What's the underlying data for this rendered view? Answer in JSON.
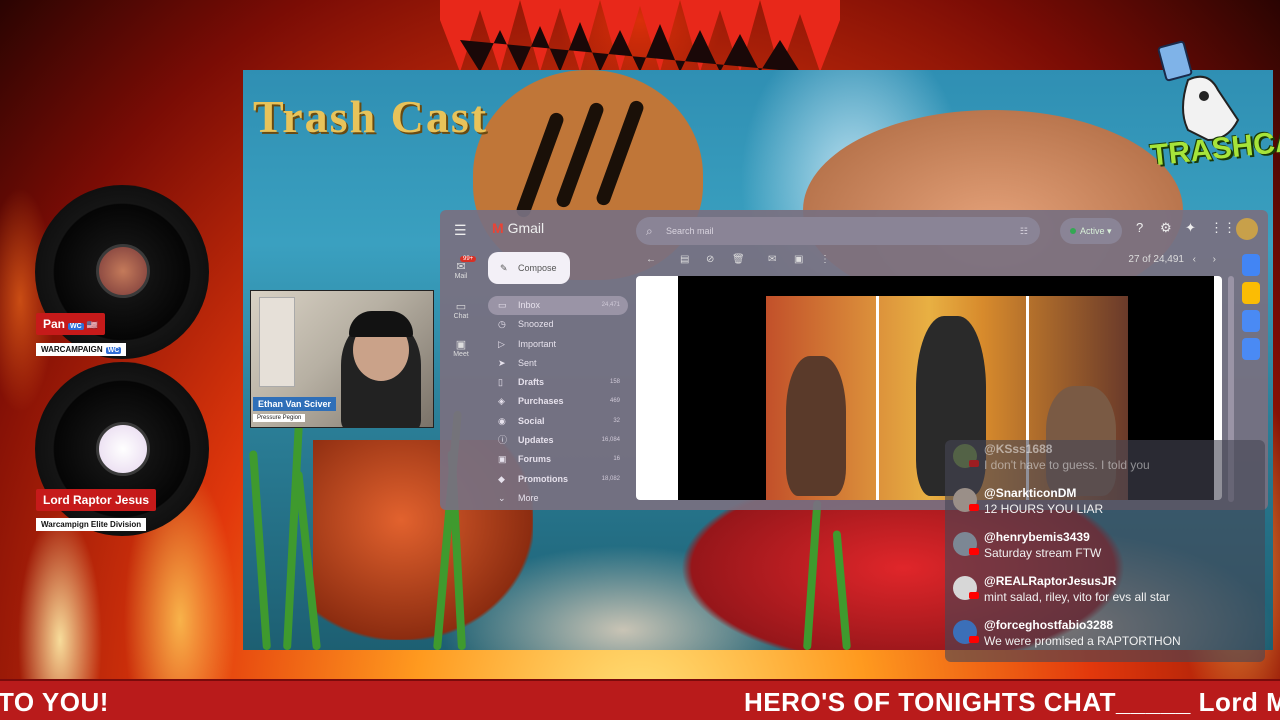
{
  "stream": {
    "brand_title": "Trash Cast",
    "logo_text": "TRASHCAST",
    "ticker_left": "TO YOU!",
    "ticker_right": "HERO'S OF TONIGHTS CHAT_____ Lord M"
  },
  "hosts": [
    {
      "name": "Pan",
      "flag": "🇺🇸",
      "badge": "WC",
      "subtitle": "WARCAMPAIGN",
      "sub_badge": "WC"
    },
    {
      "name": "Lord Raptor Jesus",
      "subtitle": "Warcampign Elite Division"
    }
  ],
  "webcam": {
    "name": "Ethan Van Sciver",
    "subtitle": "Pressure Pegion"
  },
  "gmail": {
    "app_name": "Gmail",
    "search_placeholder": "Search mail",
    "status": "Active",
    "compose_label": "Compose",
    "mail_badge": "99+",
    "page_info": "27 of 24,491",
    "rail": [
      {
        "label": "Mail",
        "icon": "mail-icon"
      },
      {
        "label": "Chat",
        "icon": "chat-icon"
      },
      {
        "label": "Meet",
        "icon": "meet-icon"
      }
    ],
    "folders": [
      {
        "label": "Inbox",
        "count": "24,471",
        "icon": "inbox-icon",
        "active": true
      },
      {
        "label": "Snoozed",
        "count": "",
        "icon": "clock-icon"
      },
      {
        "label": "Important",
        "count": "",
        "icon": "label-icon"
      },
      {
        "label": "Sent",
        "count": "",
        "icon": "send-icon"
      },
      {
        "label": "Drafts",
        "count": "158",
        "icon": "draft-icon",
        "bold": true
      },
      {
        "label": "Purchases",
        "count": "469",
        "icon": "cart-icon",
        "bold": true
      },
      {
        "label": "Social",
        "count": "32",
        "icon": "people-icon",
        "bold": true
      },
      {
        "label": "Updates",
        "count": "16,084",
        "icon": "info-icon",
        "bold": true
      },
      {
        "label": "Forums",
        "count": "16",
        "icon": "forum-icon",
        "bold": true
      },
      {
        "label": "Promotions",
        "count": "18,082",
        "icon": "tag-icon",
        "bold": true
      },
      {
        "label": "More",
        "count": "",
        "icon": "chevron-down-icon"
      }
    ]
  },
  "chat": [
    {
      "user": "@KSss1688",
      "text": "I don't have to guess. I told you",
      "color": "#6d8a4a",
      "faded": true
    },
    {
      "user": "@SnarkticonDM",
      "text": "12 HOURS YOU LIAR",
      "color": "#9a8f88"
    },
    {
      "user": "@henrybemis3439",
      "text": "Saturday stream FTW",
      "color": "#7c8794"
    },
    {
      "user": "@REALRaptorJesusJR",
      "text": "mint salad, riley, vito for evs all star",
      "color": "#d7d7d7"
    },
    {
      "user": "@forceghostfabio3288",
      "text": "We were promised a RAPTORTHON",
      "color": "#3b6fb8"
    }
  ]
}
